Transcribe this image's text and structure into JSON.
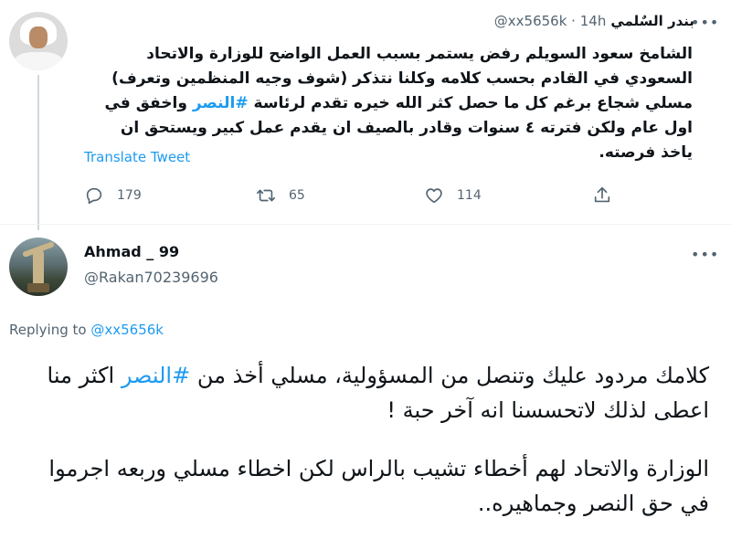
{
  "tweet1": {
    "display_name": "بندر السٌلمي",
    "handle": "@xx5656k",
    "separator": "·",
    "time": "14h",
    "text_before_hashtag": "الشامخ سعود السويلم رفض يستمر بسبب العمل الواضح للوزارة والاتحاد السعودي في القادم بحسب كلامه وكلنا نتذكر (شوف وجيه المنظمين وتعرف) مسلي شجاع برغم كل ما حصل كثر الله خيره تقدم لرئاسة",
    "hashtag": "#النصر",
    "text_after_hashtag": "واخفق في اول عام ولكن فترته ٤ سنوات وقادر بالصيف ان يقدم عمل كبير ويستحق ان ياخذ فرصته.",
    "translate_label": "Translate Tweet",
    "actions": {
      "reply_count": "179",
      "retweet_count": "65",
      "like_count": "114"
    },
    "icons": {
      "reply": "reply-icon",
      "retweet": "retweet-icon",
      "like": "heart-icon",
      "share": "share-icon",
      "more": "more-icon"
    }
  },
  "tweet2": {
    "display_name": "Ahmad _ 99",
    "handle": "@Rakan70239696",
    "replying_prefix": "Replying to",
    "replying_to": "@xx5656k",
    "paragraph1_before_hashtag": "كلامك مردود عليك وتنصل من المسؤولية، مسلي أخذ من",
    "hashtag": "#النصر",
    "paragraph1_after_hashtag": "اكثر منا اعطى لذلك لاتحسسنا انه آخر حبة !",
    "paragraph2": "الوزارة والاتحاد لهم أخطاء تشيب بالراس لكن اخطاء مسلي وربعه اجرموا في حق النصر وجماهيره.."
  },
  "colors": {
    "link": "#1d9bf0",
    "text": "#0f1419",
    "muted": "#536471",
    "border": "#eff3f4",
    "thread_line": "#cfd9de"
  }
}
